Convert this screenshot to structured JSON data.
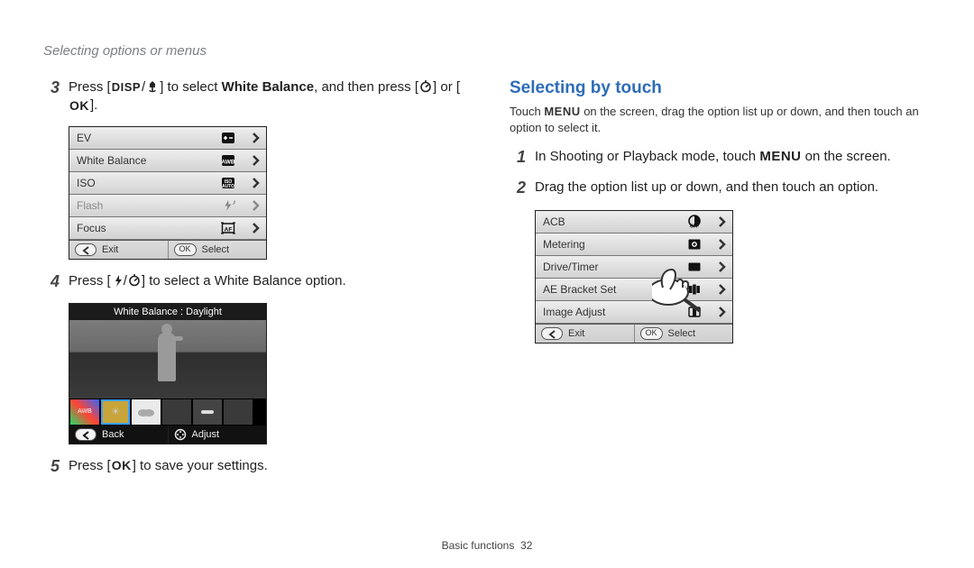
{
  "section_title": "Selecting options or menus",
  "footer": {
    "label": "Basic functions",
    "page": "32"
  },
  "left": {
    "step3": {
      "num": "3",
      "f1": "Press [",
      "f_disp": "DISP",
      "f_slash": "/",
      "f_macro": "macro-icon",
      "f2": "] to select ",
      "f_bold": "White Balance",
      "f3": ", and then press [",
      "f_timer": "timer-icon",
      "f4": "] or [",
      "f_ok": "OK",
      "f5": "]."
    },
    "panel3": {
      "rows": [
        {
          "label": "EV",
          "icon": "ev",
          "disabled": false
        },
        {
          "label": "White Balance",
          "icon": "awb",
          "disabled": false
        },
        {
          "label": "ISO",
          "icon": "iso",
          "disabled": false
        },
        {
          "label": "Flash",
          "icon": "flash",
          "disabled": true
        },
        {
          "label": "Focus",
          "icon": "af",
          "disabled": false
        }
      ],
      "bottom_left": "Exit",
      "bottom_right": "Select",
      "bottom_left_icon": "back-icon",
      "bottom_right_icon": "OK"
    },
    "step4": {
      "num": "4",
      "f1": "Press [",
      "f_flash": "flash-icon",
      "f_slash": "/",
      "f_timer": "timer-icon",
      "f2": "] to select a White Balance option."
    },
    "wb_panel": {
      "title": "White Balance : Daylight",
      "bottom_left": "Back",
      "bottom_right": "Adjust",
      "bottom_left_icon": "back-icon",
      "bottom_right_icon": "dpad-icon"
    },
    "step5": {
      "num": "5",
      "f1": "Press [",
      "f_ok": "OK",
      "f2": "] to save your settings."
    }
  },
  "right": {
    "heading": "Selecting by touch",
    "intro": {
      "f1": "Touch ",
      "f_menu": "MENU",
      "f2": " on the screen, drag the option list up or down, and then touch an option to select it."
    },
    "step1": {
      "num": "1",
      "f1": "In Shooting or Playback mode, touch ",
      "f_menu": "MENU",
      "f2": " on the screen."
    },
    "step2": {
      "num": "2",
      "f1": "Drag the option list up or down, and then touch an option."
    },
    "panel": {
      "rows": [
        {
          "label": "ACB",
          "icon": "acb"
        },
        {
          "label": "Metering",
          "icon": "meter"
        },
        {
          "label": "Drive/Timer",
          "icon": "drive"
        },
        {
          "label": "AE Bracket Set",
          "icon": "aeb"
        },
        {
          "label": "Image Adjust",
          "icon": "imgadj"
        }
      ],
      "bottom_left": "Exit",
      "bottom_right": "Select",
      "bottom_left_icon": "back-icon",
      "bottom_right_icon": "OK"
    }
  }
}
